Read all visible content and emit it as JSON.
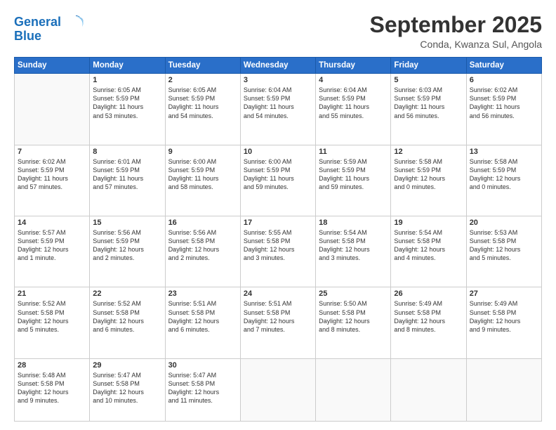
{
  "header": {
    "logo_line1": "General",
    "logo_line2": "Blue",
    "month": "September 2025",
    "location": "Conda, Kwanza Sul, Angola"
  },
  "days_of_week": [
    "Sunday",
    "Monday",
    "Tuesday",
    "Wednesday",
    "Thursday",
    "Friday",
    "Saturday"
  ],
  "weeks": [
    [
      {
        "day": "",
        "text": ""
      },
      {
        "day": "1",
        "text": "Sunrise: 6:05 AM\nSunset: 5:59 PM\nDaylight: 11 hours\nand 53 minutes."
      },
      {
        "day": "2",
        "text": "Sunrise: 6:05 AM\nSunset: 5:59 PM\nDaylight: 11 hours\nand 54 minutes."
      },
      {
        "day": "3",
        "text": "Sunrise: 6:04 AM\nSunset: 5:59 PM\nDaylight: 11 hours\nand 54 minutes."
      },
      {
        "day": "4",
        "text": "Sunrise: 6:04 AM\nSunset: 5:59 PM\nDaylight: 11 hours\nand 55 minutes."
      },
      {
        "day": "5",
        "text": "Sunrise: 6:03 AM\nSunset: 5:59 PM\nDaylight: 11 hours\nand 56 minutes."
      },
      {
        "day": "6",
        "text": "Sunrise: 6:02 AM\nSunset: 5:59 PM\nDaylight: 11 hours\nand 56 minutes."
      }
    ],
    [
      {
        "day": "7",
        "text": "Sunrise: 6:02 AM\nSunset: 5:59 PM\nDaylight: 11 hours\nand 57 minutes."
      },
      {
        "day": "8",
        "text": "Sunrise: 6:01 AM\nSunset: 5:59 PM\nDaylight: 11 hours\nand 57 minutes."
      },
      {
        "day": "9",
        "text": "Sunrise: 6:00 AM\nSunset: 5:59 PM\nDaylight: 11 hours\nand 58 minutes."
      },
      {
        "day": "10",
        "text": "Sunrise: 6:00 AM\nSunset: 5:59 PM\nDaylight: 11 hours\nand 59 minutes."
      },
      {
        "day": "11",
        "text": "Sunrise: 5:59 AM\nSunset: 5:59 PM\nDaylight: 11 hours\nand 59 minutes."
      },
      {
        "day": "12",
        "text": "Sunrise: 5:58 AM\nSunset: 5:59 PM\nDaylight: 12 hours\nand 0 minutes."
      },
      {
        "day": "13",
        "text": "Sunrise: 5:58 AM\nSunset: 5:59 PM\nDaylight: 12 hours\nand 0 minutes."
      }
    ],
    [
      {
        "day": "14",
        "text": "Sunrise: 5:57 AM\nSunset: 5:59 PM\nDaylight: 12 hours\nand 1 minute."
      },
      {
        "day": "15",
        "text": "Sunrise: 5:56 AM\nSunset: 5:59 PM\nDaylight: 12 hours\nand 2 minutes."
      },
      {
        "day": "16",
        "text": "Sunrise: 5:56 AM\nSunset: 5:58 PM\nDaylight: 12 hours\nand 2 minutes."
      },
      {
        "day": "17",
        "text": "Sunrise: 5:55 AM\nSunset: 5:58 PM\nDaylight: 12 hours\nand 3 minutes."
      },
      {
        "day": "18",
        "text": "Sunrise: 5:54 AM\nSunset: 5:58 PM\nDaylight: 12 hours\nand 3 minutes."
      },
      {
        "day": "19",
        "text": "Sunrise: 5:54 AM\nSunset: 5:58 PM\nDaylight: 12 hours\nand 4 minutes."
      },
      {
        "day": "20",
        "text": "Sunrise: 5:53 AM\nSunset: 5:58 PM\nDaylight: 12 hours\nand 5 minutes."
      }
    ],
    [
      {
        "day": "21",
        "text": "Sunrise: 5:52 AM\nSunset: 5:58 PM\nDaylight: 12 hours\nand 5 minutes."
      },
      {
        "day": "22",
        "text": "Sunrise: 5:52 AM\nSunset: 5:58 PM\nDaylight: 12 hours\nand 6 minutes."
      },
      {
        "day": "23",
        "text": "Sunrise: 5:51 AM\nSunset: 5:58 PM\nDaylight: 12 hours\nand 6 minutes."
      },
      {
        "day": "24",
        "text": "Sunrise: 5:51 AM\nSunset: 5:58 PM\nDaylight: 12 hours\nand 7 minutes."
      },
      {
        "day": "25",
        "text": "Sunrise: 5:50 AM\nSunset: 5:58 PM\nDaylight: 12 hours\nand 8 minutes."
      },
      {
        "day": "26",
        "text": "Sunrise: 5:49 AM\nSunset: 5:58 PM\nDaylight: 12 hours\nand 8 minutes."
      },
      {
        "day": "27",
        "text": "Sunrise: 5:49 AM\nSunset: 5:58 PM\nDaylight: 12 hours\nand 9 minutes."
      }
    ],
    [
      {
        "day": "28",
        "text": "Sunrise: 5:48 AM\nSunset: 5:58 PM\nDaylight: 12 hours\nand 9 minutes."
      },
      {
        "day": "29",
        "text": "Sunrise: 5:47 AM\nSunset: 5:58 PM\nDaylight: 12 hours\nand 10 minutes."
      },
      {
        "day": "30",
        "text": "Sunrise: 5:47 AM\nSunset: 5:58 PM\nDaylight: 12 hours\nand 11 minutes."
      },
      {
        "day": "",
        "text": ""
      },
      {
        "day": "",
        "text": ""
      },
      {
        "day": "",
        "text": ""
      },
      {
        "day": "",
        "text": ""
      }
    ]
  ]
}
